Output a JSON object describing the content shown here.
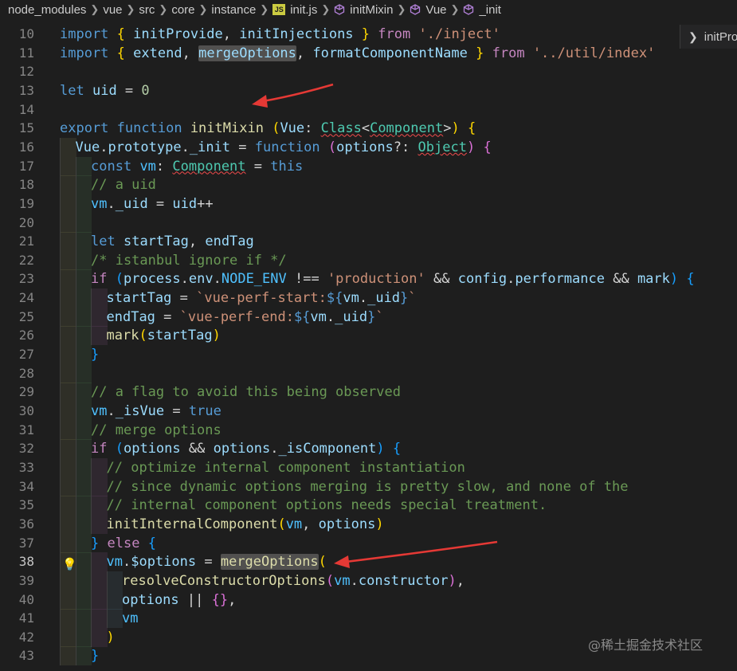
{
  "breadcrumb": {
    "items": [
      "node_modules",
      "vue",
      "src",
      "core",
      "instance",
      "init.js",
      "initMixin",
      "Vue",
      "_init"
    ]
  },
  "outline": {
    "label": "initProvide"
  },
  "watermark": "@稀土掘金技术社区",
  "colors": {
    "keyword": "#569cd6",
    "control": "#c586c0",
    "function": "#dcdcaa",
    "variable": "#9cdcfe",
    "type": "#4ec9b0",
    "string": "#ce9178",
    "comment": "#6a9955",
    "arrow": "#e53935"
  },
  "active_line": 38,
  "lines": [
    {
      "n": "10",
      "indent": 0,
      "t": [
        [
          "kw",
          "import"
        ],
        [
          "p",
          " "
        ],
        [
          "b1",
          "{"
        ],
        [
          "p",
          " "
        ],
        [
          "var",
          "initProvide"
        ],
        [
          "p",
          ", "
        ],
        [
          "var",
          "initInjections"
        ],
        [
          "p",
          " "
        ],
        [
          "b1",
          "}"
        ],
        [
          "p",
          " "
        ],
        [
          "ctl",
          "from"
        ],
        [
          "p",
          " "
        ],
        [
          "str",
          "'./inject'"
        ]
      ]
    },
    {
      "n": "11",
      "indent": 0,
      "t": [
        [
          "kw",
          "import"
        ],
        [
          "p",
          " "
        ],
        [
          "b1",
          "{"
        ],
        [
          "p",
          " "
        ],
        [
          "var",
          "extend"
        ],
        [
          "p",
          ", "
        ],
        [
          "varhl",
          "mergeOptions"
        ],
        [
          "p",
          ", "
        ],
        [
          "var",
          "formatComponentName"
        ],
        [
          "p",
          " "
        ],
        [
          "b1",
          "}"
        ],
        [
          "p",
          " "
        ],
        [
          "ctl",
          "from"
        ],
        [
          "p",
          " "
        ],
        [
          "str",
          "'../util/index'"
        ]
      ]
    },
    {
      "n": "12",
      "indent": 0,
      "t": []
    },
    {
      "n": "13",
      "indent": 0,
      "t": [
        [
          "kw",
          "let"
        ],
        [
          "p",
          " "
        ],
        [
          "var",
          "uid"
        ],
        [
          "p",
          " = "
        ],
        [
          "num",
          "0"
        ]
      ]
    },
    {
      "n": "14",
      "indent": 0,
      "t": []
    },
    {
      "n": "15",
      "indent": 0,
      "t": [
        [
          "kw",
          "export"
        ],
        [
          "p",
          " "
        ],
        [
          "kw",
          "function"
        ],
        [
          "p",
          " "
        ],
        [
          "fn",
          "initMixin"
        ],
        [
          "p",
          " "
        ],
        [
          "b1",
          "("
        ],
        [
          "var",
          "Vue"
        ],
        [
          "p",
          ": "
        ],
        [
          "typesq",
          "Class"
        ],
        [
          "p",
          "<"
        ],
        [
          "typesq",
          "Component"
        ],
        [
          "p",
          ">"
        ],
        [
          "b1",
          ")"
        ],
        [
          "p",
          " "
        ],
        [
          "b1",
          "{"
        ]
      ]
    },
    {
      "n": "16",
      "indent": 1,
      "t": [
        [
          "var",
          "Vue"
        ],
        [
          "p",
          "."
        ],
        [
          "var",
          "prototype"
        ],
        [
          "p",
          "."
        ],
        [
          "var",
          "_init"
        ],
        [
          "p",
          " = "
        ],
        [
          "kw",
          "function"
        ],
        [
          "p",
          " "
        ],
        [
          "b2",
          "("
        ],
        [
          "var",
          "options"
        ],
        [
          "p",
          "?: "
        ],
        [
          "typesq",
          "Object"
        ],
        [
          "b2",
          ")"
        ],
        [
          "p",
          " "
        ],
        [
          "b2",
          "{"
        ]
      ]
    },
    {
      "n": "17",
      "indent": 2,
      "t": [
        [
          "kw",
          "const"
        ],
        [
          "p",
          " "
        ],
        [
          "const",
          "vm"
        ],
        [
          "p",
          ": "
        ],
        [
          "typesq",
          "Component"
        ],
        [
          "p",
          " = "
        ],
        [
          "kw",
          "this"
        ]
      ]
    },
    {
      "n": "18",
      "indent": 2,
      "t": [
        [
          "cm",
          "// a uid"
        ]
      ]
    },
    {
      "n": "19",
      "indent": 2,
      "t": [
        [
          "const",
          "vm"
        ],
        [
          "p",
          "."
        ],
        [
          "var",
          "_uid"
        ],
        [
          "p",
          " = "
        ],
        [
          "var",
          "uid"
        ],
        [
          "p",
          "++"
        ]
      ]
    },
    {
      "n": "20",
      "indent": 2,
      "t": []
    },
    {
      "n": "21",
      "indent": 2,
      "t": [
        [
          "kw",
          "let"
        ],
        [
          "p",
          " "
        ],
        [
          "var",
          "startTag"
        ],
        [
          "p",
          ", "
        ],
        [
          "var",
          "endTag"
        ]
      ]
    },
    {
      "n": "22",
      "indent": 2,
      "t": [
        [
          "cm",
          "/* istanbul ignore if */"
        ]
      ]
    },
    {
      "n": "23",
      "indent": 2,
      "t": [
        [
          "ctl",
          "if"
        ],
        [
          "p",
          " "
        ],
        [
          "b3",
          "("
        ],
        [
          "var",
          "process"
        ],
        [
          "p",
          "."
        ],
        [
          "var",
          "env"
        ],
        [
          "p",
          "."
        ],
        [
          "const",
          "NODE_ENV"
        ],
        [
          "p",
          " !== "
        ],
        [
          "str",
          "'production'"
        ],
        [
          "p",
          " && "
        ],
        [
          "var",
          "config"
        ],
        [
          "p",
          "."
        ],
        [
          "var",
          "performance"
        ],
        [
          "p",
          " && "
        ],
        [
          "var",
          "mark"
        ],
        [
          "b3",
          ")"
        ],
        [
          "p",
          " "
        ],
        [
          "b3",
          "{"
        ]
      ]
    },
    {
      "n": "24",
      "indent": 3,
      "t": [
        [
          "var",
          "startTag"
        ],
        [
          "p",
          " = "
        ],
        [
          "str",
          "`vue-perf-start:"
        ],
        [
          "kw",
          "${"
        ],
        [
          "var",
          "vm"
        ],
        [
          "p",
          "."
        ],
        [
          "var",
          "_uid"
        ],
        [
          "kw",
          "}"
        ],
        [
          "str",
          "`"
        ]
      ]
    },
    {
      "n": "25",
      "indent": 3,
      "t": [
        [
          "var",
          "endTag"
        ],
        [
          "p",
          " = "
        ],
        [
          "str",
          "`vue-perf-end:"
        ],
        [
          "kw",
          "${"
        ],
        [
          "var",
          "vm"
        ],
        [
          "p",
          "."
        ],
        [
          "var",
          "_uid"
        ],
        [
          "kw",
          "}"
        ],
        [
          "str",
          "`"
        ]
      ]
    },
    {
      "n": "26",
      "indent": 3,
      "t": [
        [
          "fn",
          "mark"
        ],
        [
          "b1",
          "("
        ],
        [
          "var",
          "startTag"
        ],
        [
          "b1",
          ")"
        ]
      ]
    },
    {
      "n": "27",
      "indent": 2,
      "t": [
        [
          "b3",
          "}"
        ]
      ]
    },
    {
      "n": "28",
      "indent": 2,
      "t": []
    },
    {
      "n": "29",
      "indent": 2,
      "t": [
        [
          "cm",
          "// a flag to avoid this being observed"
        ]
      ]
    },
    {
      "n": "30",
      "indent": 2,
      "t": [
        [
          "const",
          "vm"
        ],
        [
          "p",
          "."
        ],
        [
          "var",
          "_isVue"
        ],
        [
          "p",
          " = "
        ],
        [
          "kw",
          "true"
        ]
      ]
    },
    {
      "n": "31",
      "indent": 2,
      "t": [
        [
          "cm",
          "// merge options"
        ]
      ]
    },
    {
      "n": "32",
      "indent": 2,
      "t": [
        [
          "ctl",
          "if"
        ],
        [
          "p",
          " "
        ],
        [
          "b3",
          "("
        ],
        [
          "var",
          "options"
        ],
        [
          "p",
          " && "
        ],
        [
          "var",
          "options"
        ],
        [
          "p",
          "."
        ],
        [
          "var",
          "_isComponent"
        ],
        [
          "b3",
          ")"
        ],
        [
          "p",
          " "
        ],
        [
          "b3",
          "{"
        ]
      ]
    },
    {
      "n": "33",
      "indent": 3,
      "t": [
        [
          "cm",
          "// optimize internal component instantiation"
        ]
      ]
    },
    {
      "n": "34",
      "indent": 3,
      "t": [
        [
          "cm",
          "// since dynamic options merging is pretty slow, and none of the"
        ]
      ]
    },
    {
      "n": "35",
      "indent": 3,
      "t": [
        [
          "cm",
          "// internal component options needs special treatment."
        ]
      ]
    },
    {
      "n": "36",
      "indent": 3,
      "t": [
        [
          "fn",
          "initInternalComponent"
        ],
        [
          "b1",
          "("
        ],
        [
          "const",
          "vm"
        ],
        [
          "p",
          ", "
        ],
        [
          "var",
          "options"
        ],
        [
          "b1",
          ")"
        ]
      ]
    },
    {
      "n": "37",
      "indent": 2,
      "t": [
        [
          "b3",
          "}"
        ],
        [
          "p",
          " "
        ],
        [
          "ctl",
          "else"
        ],
        [
          "p",
          " "
        ],
        [
          "b3",
          "{"
        ]
      ]
    },
    {
      "n": "38",
      "indent": 3,
      "t": [
        [
          "const",
          "vm"
        ],
        [
          "p",
          "."
        ],
        [
          "var",
          "$options"
        ],
        [
          "p",
          " = "
        ],
        [
          "fnhl",
          "mergeOptions"
        ],
        [
          "b1",
          "("
        ]
      ]
    },
    {
      "n": "39",
      "indent": 4,
      "t": [
        [
          "fn",
          "resolveConstructorOptions"
        ],
        [
          "b2",
          "("
        ],
        [
          "const",
          "vm"
        ],
        [
          "p",
          "."
        ],
        [
          "var",
          "constructor"
        ],
        [
          "b2",
          ")"
        ],
        [
          "p",
          ","
        ]
      ]
    },
    {
      "n": "40",
      "indent": 4,
      "t": [
        [
          "var",
          "options"
        ],
        [
          "p",
          " || "
        ],
        [
          "b2",
          "{}"
        ],
        [
          "p",
          ","
        ]
      ]
    },
    {
      "n": "41",
      "indent": 4,
      "t": [
        [
          "const",
          "vm"
        ]
      ]
    },
    {
      "n": "42",
      "indent": 3,
      "t": [
        [
          "b1",
          ")"
        ]
      ]
    },
    {
      "n": "43",
      "indent": 2,
      "t": [
        [
          "b3",
          "}"
        ]
      ]
    }
  ]
}
